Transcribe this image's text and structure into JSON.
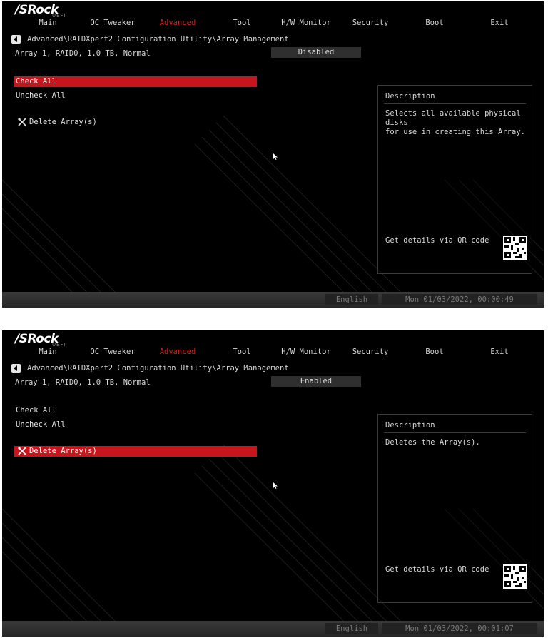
{
  "screens": [
    {
      "logo": "/SRock",
      "logo_sub": "UEFI",
      "menu": [
        "Main",
        "OC Tweaker",
        "Advanced",
        "Tool",
        "H/W Monitor",
        "Security",
        "Boot",
        "Exit"
      ],
      "active_menu": "Advanced",
      "breadcrumb": "Advanced\\RAIDXpert2 Configuration Utility\\Array Management",
      "array_label": "Array 1, RAID0, 1.0 TB, Normal",
      "array_status": "Disabled",
      "options": [
        "Check All",
        "Uncheck All",
        "Delete Array(s)"
      ],
      "selected_option": "Check All",
      "description_title": "Description",
      "description_text": "Selects all available physical disks\nfor use in creating this Array.",
      "qr_label": "Get details via QR code",
      "language": "English",
      "datetime": "Mon 01/03/2022, 00:00:49"
    },
    {
      "logo": "/SRock",
      "logo_sub": "UEFI",
      "menu": [
        "Main",
        "OC Tweaker",
        "Advanced",
        "Tool",
        "H/W Monitor",
        "Security",
        "Boot",
        "Exit"
      ],
      "active_menu": "Advanced",
      "breadcrumb": "Advanced\\RAIDXpert2 Configuration Utility\\Array Management",
      "array_label": "Array 1, RAID0, 1.0 TB, Normal",
      "array_status": "Enabled",
      "options": [
        "Check All",
        "Uncheck All",
        "Delete Array(s)"
      ],
      "selected_option": "Delete Array(s)",
      "description_title": "Description",
      "description_text": "Deletes the Array(s).",
      "qr_label": "Get details via QR code",
      "language": "English",
      "datetime": "Mon 01/03/2022, 00:01:07"
    }
  ],
  "colors": {
    "accent": "#c4161c",
    "active_menu": "#d21e1e",
    "background": "#000000",
    "text": "#d9d9d9"
  },
  "icons": {
    "back": "back-arrow-icon",
    "delete": "wrench-screwdriver-icon",
    "qr": "qr-code-icon",
    "cursor": "mouse-pointer-icon"
  }
}
